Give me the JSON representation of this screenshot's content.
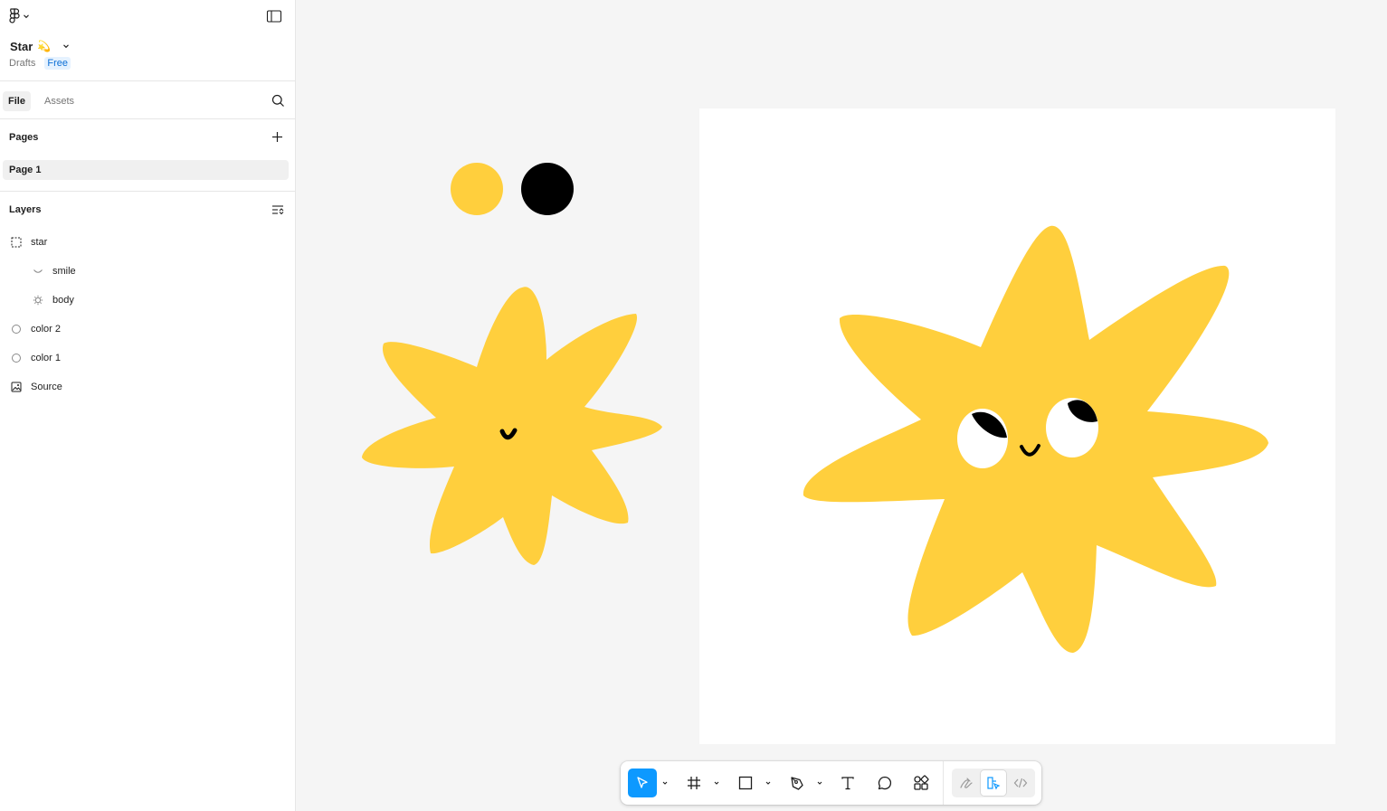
{
  "file": {
    "name": "Star",
    "emoji": "💫",
    "location": "Drafts",
    "plan_badge": "Free"
  },
  "tabs": {
    "file": "File",
    "assets": "Assets"
  },
  "pages": {
    "header": "Pages",
    "items": [
      "Page 1"
    ]
  },
  "layers": {
    "header": "Layers",
    "items": [
      {
        "label": "star",
        "icon": "frame-icon",
        "depth": 0
      },
      {
        "label": "smile",
        "icon": "vector-icon",
        "depth": 1
      },
      {
        "label": "body",
        "icon": "star-shape-icon",
        "depth": 1
      },
      {
        "label": "color 2",
        "icon": "ellipse-icon",
        "depth": 0
      },
      {
        "label": "color 1",
        "icon": "ellipse-icon",
        "depth": 0
      },
      {
        "label": "Source",
        "icon": "image-icon",
        "depth": 0
      }
    ]
  },
  "canvas": {
    "background": "#f5f5f5",
    "frame_fill": "#ffffff",
    "swatches": [
      "#ffcf3d",
      "#000000"
    ],
    "star_color": "#ffcf3d",
    "eye_white": "#ffffff",
    "ink": "#000000"
  },
  "toolbar": {
    "accent": "#0d99ff",
    "tools": [
      "move-tool",
      "frame-tool",
      "shape-tool",
      "pen-tool",
      "text-tool",
      "comment-tool",
      "actions-tool"
    ],
    "modes": [
      "draw-mode",
      "design-mode",
      "dev-mode"
    ],
    "active_tool": "move-tool",
    "active_mode": "design-mode"
  }
}
